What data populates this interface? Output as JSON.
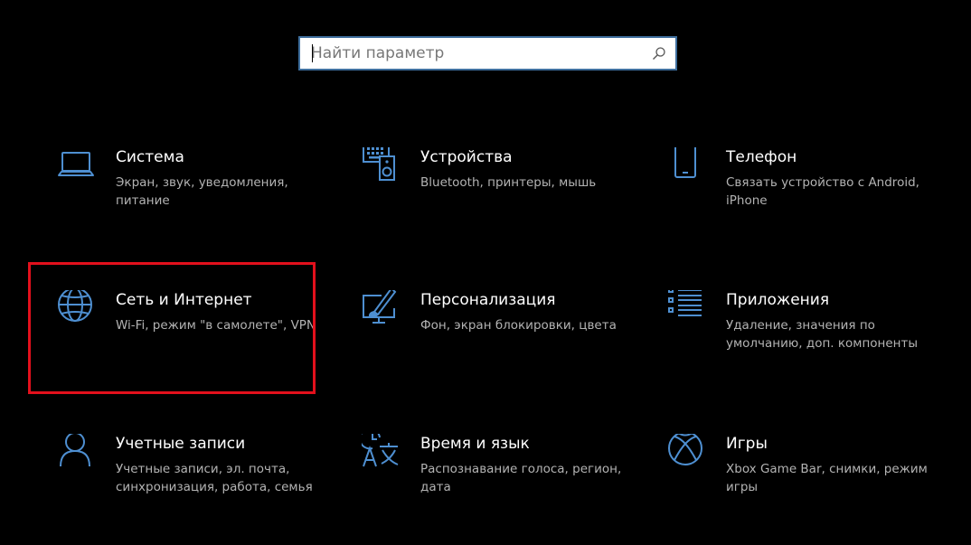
{
  "search": {
    "placeholder": "Найти параметр",
    "value": ""
  },
  "colors": {
    "accent": "#3f6f9e",
    "icon": "#4e8fd1",
    "highlight": "#e3101c",
    "background": "#000000"
  },
  "tiles": [
    {
      "icon": "laptop-icon",
      "title": "Система",
      "desc": "Экран, звук, уведомления, питание"
    },
    {
      "icon": "keyboard-speaker-icon",
      "title": "Устройства",
      "desc": "Bluetooth, принтеры, мышь"
    },
    {
      "icon": "phone-icon",
      "title": "Телефон",
      "desc": "Связать устройство с Android, iPhone"
    },
    {
      "icon": "globe-icon",
      "title": "Сеть и Интернет",
      "desc": "Wi-Fi, режим \"в самолете\", VPN"
    },
    {
      "icon": "paintbrush-icon",
      "title": "Персонализация",
      "desc": "Фон, экран блокировки, цвета"
    },
    {
      "icon": "app-list-icon",
      "title": "Приложения",
      "desc": "Удаление, значения по умолчанию, доп. компоненты"
    },
    {
      "icon": "person-icon",
      "title": "Учетные записи",
      "desc": "Учетные записи, эл. почта, синхронизация, работа, семья"
    },
    {
      "icon": "time-language-icon",
      "title": "Время и язык",
      "desc": "Распознавание голоса, регион, дата"
    },
    {
      "icon": "xbox-icon",
      "title": "Игры",
      "desc": "Xbox Game Bar, снимки, режим игры"
    }
  ]
}
